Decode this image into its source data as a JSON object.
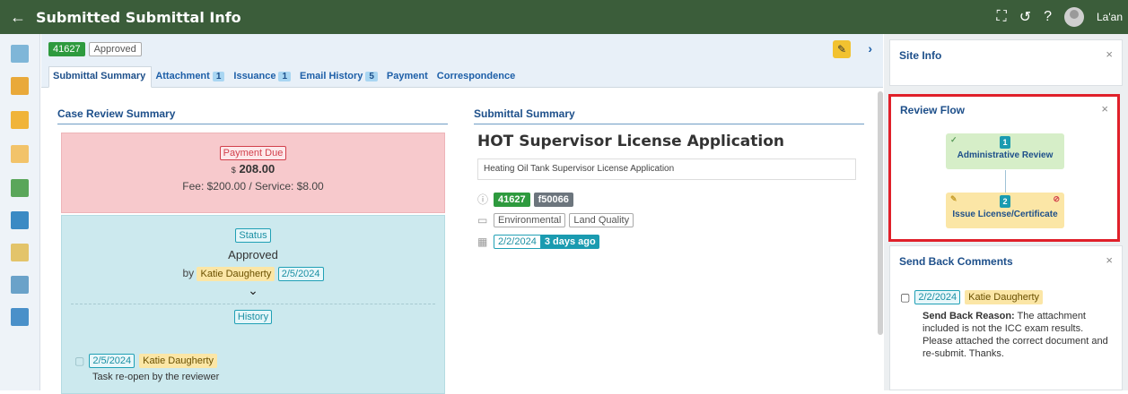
{
  "app": {
    "title": "Submitted Submittal Info",
    "user_name": "La'an"
  },
  "header_icons": [
    "fullscreen-icon",
    "history-icon",
    "help-icon",
    "avatar"
  ],
  "submittal": {
    "id": "41627",
    "status": "Approved"
  },
  "tabs": [
    {
      "label": "Submittal Summary",
      "count": null
    },
    {
      "label": "Attachment",
      "count": "1"
    },
    {
      "label": "Issuance",
      "count": "1"
    },
    {
      "label": "Email History",
      "count": "5"
    },
    {
      "label": "Payment",
      "count": null
    },
    {
      "label": "Correspondence",
      "count": null
    }
  ],
  "case_review": {
    "heading": "Case Review Summary",
    "payment": {
      "label": "Payment Due",
      "currency": "$",
      "amount": "208.00",
      "fee_line": "Fee: $200.00  /  Service: $8.00"
    },
    "status": {
      "label": "Status",
      "value": "Approved",
      "by": "by",
      "person": "Katie Daugherty",
      "date": "2/5/2024"
    },
    "history": {
      "label": "History",
      "date": "2/5/2024",
      "person": "Katie Daugherty",
      "text": "Task re-open by the reviewer"
    }
  },
  "summary": {
    "heading": "Submittal Summary",
    "title": "HOT Supervisor License Application",
    "description": "Heating Oil Tank Supervisor License Application",
    "id": "41627",
    "code": "f50066",
    "tags": [
      "Environmental",
      "Land Quality"
    ],
    "date": "2/2/2024",
    "ago": "3 days ago"
  },
  "site_info": {
    "title": "Site Info"
  },
  "review_flow": {
    "title": "Review Flow",
    "steps": [
      {
        "num": "1",
        "label": "Administrative Review"
      },
      {
        "num": "2",
        "label": "Issue License/Certificate"
      }
    ]
  },
  "send_back": {
    "title": "Send Back Comments",
    "date": "2/2/2024",
    "person": "Katie Daugherty",
    "reason_label": "Send Back Reason:",
    "reason_text": " The attachment included is not the ICC exam results. Please attached the correct document and re-submit. Thanks."
  },
  "colors": {
    "topbar": "#3b5d3a",
    "highlight": "#e0202a",
    "accent": "#1d4f8a"
  }
}
